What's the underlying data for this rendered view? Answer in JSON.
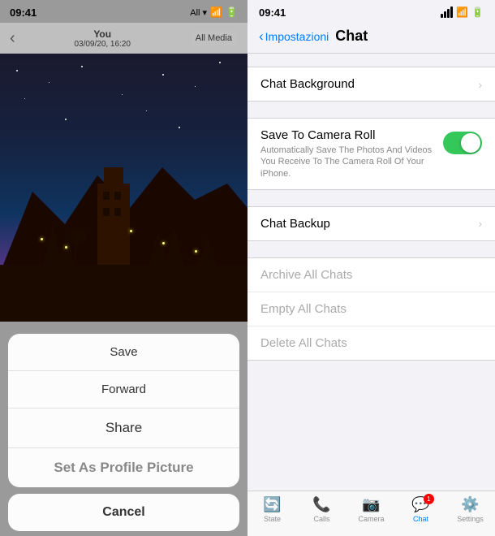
{
  "left": {
    "status_bar": {
      "time": "09:41",
      "network": "All ▾",
      "wifi": "WiFi",
      "battery": "■"
    },
    "header": {
      "back_arrow": "‹",
      "you_label": "You",
      "date": "03/09/20, 16:20",
      "all_media_btn": "All Media"
    },
    "action_sheet": {
      "save": "Save",
      "forward": "Forward",
      "share": "Share",
      "set_profile": "Set As Profile Picture",
      "cancel": "Cancel"
    }
  },
  "right": {
    "status_bar": {
      "time": "09:41",
      "network": "All",
      "wifi": "WiFi"
    },
    "header": {
      "back_label": "Impostazioni",
      "title": "Chat"
    },
    "settings": {
      "group1": [
        {
          "label": "Chat Background",
          "type": "chevron"
        }
      ],
      "group2": [
        {
          "label": "Save To Camera Roll",
          "sublabel": "Automatically Save The Photos And Videos You Receive To The Camera Roll Of Your iPhone.",
          "type": "toggle",
          "value": true
        }
      ],
      "group3": [
        {
          "label": "Chat Backup",
          "type": "chevron"
        }
      ],
      "group4": [
        {
          "label": "Archive All Chats",
          "type": "danger"
        },
        {
          "label": "Empty All Chats",
          "type": "danger"
        },
        {
          "label": "Delete All Chats",
          "type": "danger"
        }
      ]
    },
    "tab_bar": {
      "items": [
        {
          "icon": "⟳",
          "label": "State",
          "active": false
        },
        {
          "icon": "📞",
          "label": "Calls",
          "active": false
        },
        {
          "icon": "📷",
          "label": "Camera",
          "active": false
        },
        {
          "icon": "💬",
          "label": "Chat",
          "active": true,
          "badge": "1"
        },
        {
          "icon": "⚙",
          "label": "Settings",
          "active": false
        }
      ]
    }
  }
}
